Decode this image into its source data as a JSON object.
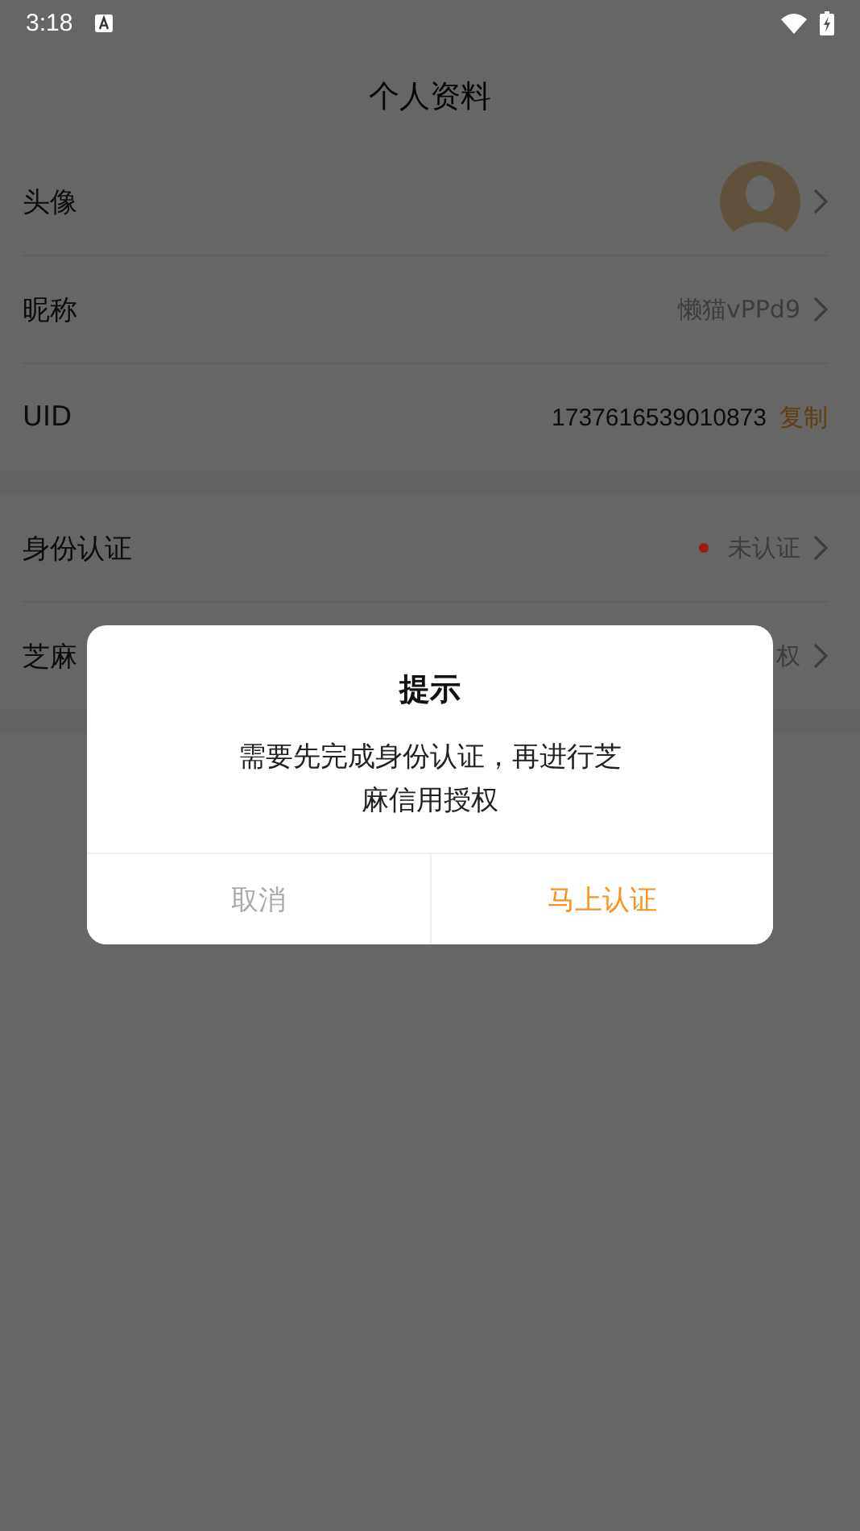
{
  "status_bar": {
    "time": "3:18"
  },
  "header": {
    "title": "个人资料"
  },
  "sections": [
    {
      "rows": [
        {
          "kind": "avatar",
          "label": "头像",
          "chevron": true
        },
        {
          "kind": "text",
          "label": "昵称",
          "value": "懒猫vPPd9",
          "chevron": true
        },
        {
          "kind": "copy",
          "label": "UID",
          "value": "1737616539010873",
          "action": "复制",
          "chevron": false
        }
      ]
    },
    {
      "rows": [
        {
          "kind": "status",
          "label": "身份认证",
          "value": "未认证",
          "color": "#9e1a10",
          "chevron": true
        },
        {
          "kind": "text",
          "label": "芝麻",
          "value": "权",
          "chevron": true
        }
      ]
    }
  ],
  "dialog": {
    "title": "提示",
    "message": "需要先完成身份认证，再进行芝麻信用授权",
    "buttons": [
      {
        "label": "取消",
        "primary": false
      },
      {
        "label": "马上认证",
        "primary": true
      }
    ]
  }
}
